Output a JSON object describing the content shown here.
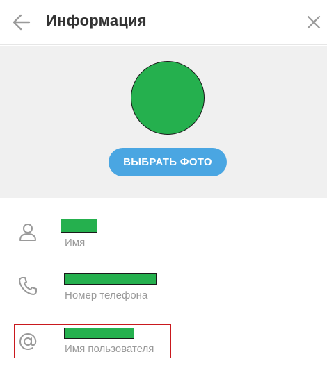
{
  "header": {
    "title": "Информация",
    "back_icon": "arrow-left-icon",
    "close_icon": "close-icon"
  },
  "photo": {
    "choose_label": "ВЫБРАТЬ ФОТО"
  },
  "fields": [
    {
      "icon": "person-icon",
      "value": "[redacted]",
      "label": "Имя"
    },
    {
      "icon": "phone-icon",
      "value": "[redacted]",
      "label": "Номер телефона"
    },
    {
      "icon": "at-icon",
      "value": "[redacted]",
      "label": "Имя пользователя"
    }
  ],
  "colors": {
    "accent": "#4aa6e2",
    "redaction": "#25b04e",
    "highlight": "#c9191e",
    "icon": "#9a9a9a"
  }
}
